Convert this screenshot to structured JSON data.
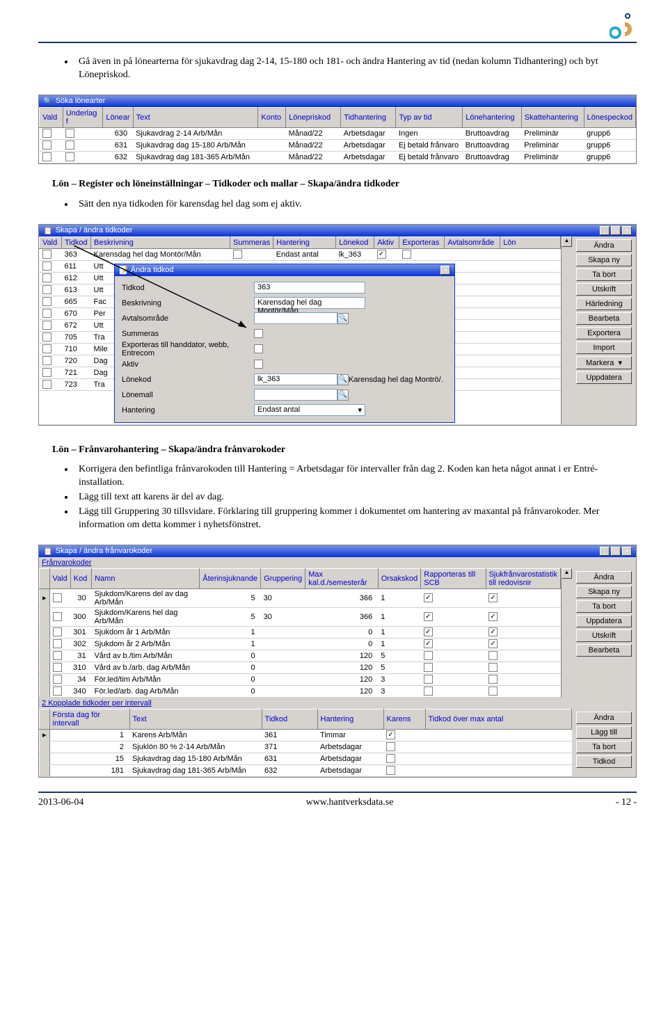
{
  "logo_colors": {
    "top": "#0a3a7a",
    "middle": "#2aa7c7",
    "bottom": "#d7a24a"
  },
  "intro": "Gå även in på lönearterna för sjukavdrag dag 2-14, 15-180 och 181- och ändra Hantering av tid (nedan kolumn Tidhantering) och byt Lönepriskod.",
  "win1": {
    "title": "Söka lönearter",
    "headers": [
      "Vald",
      "Underlag f",
      "Lönear",
      "Text",
      "Konto",
      "Lönepriskod",
      "Tidhantering",
      "Typ av tid",
      "Lönehantering",
      "Skattehantering",
      "Lönespeckod"
    ],
    "rows": [
      {
        "lonear": "630",
        "text": "Sjukavdrag 2-14 Arb/Mån",
        "konto": "",
        "priskod": "Månad/22",
        "tidh": "Arbetsdagar",
        "typ": "Ingen",
        "loneh": "Bruttoavdrag",
        "skatt": "Preliminär",
        "spec": "grupp6"
      },
      {
        "lonear": "631",
        "text": "Sjukavdrag dag 15-180 Arb/Mån",
        "konto": "",
        "priskod": "Månad/22",
        "tidh": "Arbetsdagar",
        "typ": "Ej betald frånvaro",
        "loneh": "Bruttoavdrag",
        "skatt": "Preliminär",
        "spec": "grupp6"
      },
      {
        "lonear": "632",
        "text": "Sjukavdrag dag 181-365 Arb/Mån",
        "konto": "",
        "priskod": "Månad/22",
        "tidh": "Arbetsdagar",
        "typ": "Ej betald frånvaro",
        "loneh": "Bruttoavdrag",
        "skatt": "Preliminär",
        "spec": "grupp6"
      }
    ]
  },
  "heading2": "Lön – Register och löneinställningar – Tidkoder och mallar – Skapa/ändra tidkoder",
  "bullet2": "Sätt den nya tidkoden för karensdag hel dag som ej aktiv.",
  "win2": {
    "title": "Skapa / ändra tidkoder",
    "headers": [
      "Vald",
      "Tidkod",
      "Beskrivning",
      "Summeras",
      "Hantering",
      "Lönekod",
      "Aktiv",
      "Exporteras",
      "Avtalsområde",
      "Lön"
    ],
    "buttons": [
      "Ändra",
      "Skapa ny",
      "Ta bort",
      "Utskrift",
      "Härledning",
      "Bearbeta",
      "Exportera",
      "Import",
      "Markera",
      "Uppdatera"
    ],
    "rows": [
      {
        "tidkod": "363",
        "beskr": "Karensdag hel dag Montör/Mån",
        "sum": false,
        "hant": "Endast antal",
        "lone": "lk_363",
        "aktiv": true,
        "exp": false
      },
      {
        "tidkod": "611",
        "beskr": "Utt"
      },
      {
        "tidkod": "612",
        "beskr": "Utt"
      },
      {
        "tidkod": "613",
        "beskr": "Utt"
      },
      {
        "tidkod": "665",
        "beskr": "Fac"
      },
      {
        "tidkod": "670",
        "beskr": "Per"
      },
      {
        "tidkod": "672",
        "beskr": "Utt"
      },
      {
        "tidkod": "705",
        "beskr": "Tra"
      },
      {
        "tidkod": "710",
        "beskr": "Mile"
      },
      {
        "tidkod": "720",
        "beskr": "Dag"
      },
      {
        "tidkod": "721",
        "beskr": "Dag"
      },
      {
        "tidkod": "723",
        "beskr": "Tra"
      }
    ],
    "dialog": {
      "title": "Ändra tidkod",
      "fields": [
        {
          "label": "Tidkod",
          "value": "363",
          "type": "text"
        },
        {
          "label": "Beskrivning",
          "value": "Karensdag hel dag Montör/Mån",
          "type": "text"
        },
        {
          "label": "Avtalsområde",
          "value": "",
          "type": "textsearch"
        },
        {
          "label": "Summeras",
          "value": false,
          "type": "check"
        },
        {
          "label": "Exporteras till handdator, webb, Entrecom",
          "value": false,
          "type": "check"
        },
        {
          "label": "Aktiv",
          "value": false,
          "type": "check"
        },
        {
          "label": "Lönekod",
          "value": "lk_363",
          "type": "textsearch",
          "suffix": "Karensdag hel dag Montrö/."
        },
        {
          "label": "Lönemall",
          "value": "",
          "type": "textsearch"
        },
        {
          "label": "Hantering",
          "value": "Endast antal",
          "type": "select"
        }
      ]
    }
  },
  "heading3": "Lön – Frånvarohantering – Skapa/ändra frånvarokoder",
  "bullets3": [
    "Korrigera den befintliga frånvarokoden till Hantering = Arbetsdagar för intervaller från dag 2. Koden kan heta något annat i er Entré-installation.",
    "Lägg till text att karens är del av dag.",
    "Lägg till Gruppering 30 tillsvidare. Förklaring till gruppering kommer i dokumentet om hantering av maxantal på frånvarokoder. Mer information om detta kommer i nyhetsfönstret."
  ],
  "win3": {
    "title": "Skapa / ändra frånvarokoder",
    "section1": "Frånvarokoder",
    "headers1": [
      "Vald",
      "Kod",
      "Namn",
      "Återinsjuknande",
      "Gruppering",
      "Max kal.d./semesterår",
      "Orsakskod",
      "Rapporteras till SCB",
      "Sjukfrånvarostatistik till redovisnir"
    ],
    "buttons1": [
      "Ändra",
      "Skapa ny",
      "Ta bort",
      "Uppdatera",
      "Utskrift",
      "Bearbeta"
    ],
    "rows1": [
      {
        "kod": "30",
        "namn": "Sjukdom/Karens del av dag Arb/Mån",
        "ater": "5",
        "grupp": "30",
        "max": "366",
        "ors": "1",
        "scb": true,
        "sjuk": true,
        "sel": true
      },
      {
        "kod": "300",
        "namn": "Sjukdom/Karens hel dag Arb/Mån",
        "ater": "5",
        "grupp": "30",
        "max": "366",
        "ors": "1",
        "scb": true,
        "sjuk": true
      },
      {
        "kod": "301",
        "namn": "Sjukdom år 1 Arb/Mån",
        "ater": "1",
        "grupp": "",
        "max": "0",
        "ors": "1",
        "scb": true,
        "sjuk": true
      },
      {
        "kod": "302",
        "namn": "Sjukdom år 2 Arb/Mån",
        "ater": "1",
        "grupp": "",
        "max": "0",
        "ors": "1",
        "scb": true,
        "sjuk": true
      },
      {
        "kod": "31",
        "namn": "Vård av b./tim Arb/Mån",
        "ater": "0",
        "grupp": "",
        "max": "120",
        "ors": "5",
        "scb": false,
        "sjuk": false
      },
      {
        "kod": "310",
        "namn": "Vård av b./arb. dag Arb/Mån",
        "ater": "0",
        "grupp": "",
        "max": "120",
        "ors": "5",
        "scb": false,
        "sjuk": false
      },
      {
        "kod": "34",
        "namn": "För.led/tim Arb/Mån",
        "ater": "0",
        "grupp": "",
        "max": "120",
        "ors": "3",
        "scb": false,
        "sjuk": false
      },
      {
        "kod": "340",
        "namn": "För.led/arb. dag Arb/Mån",
        "ater": "0",
        "grupp": "",
        "max": "120",
        "ors": "3",
        "scb": false,
        "sjuk": false
      }
    ],
    "section2": "Kopplade tidkoder per intervall",
    "headers2": [
      "Första dag för intervall",
      "Text",
      "Tidkod",
      "Hantering",
      "Karens",
      "Tidkod över max antal"
    ],
    "buttons2": [
      "Ändra",
      "Lägg till",
      "Ta bort",
      "Tidkod"
    ],
    "rows2": [
      {
        "dag": "1",
        "text": "Karens Arb/Mån",
        "tidkod": "361",
        "hant": "Timmar",
        "karens": true,
        "sel": true
      },
      {
        "dag": "2",
        "text": "Sjuklön 80 % 2-14 Arb/Mån",
        "tidkod": "371",
        "hant": "Arbetsdagar",
        "karens": false
      },
      {
        "dag": "15",
        "text": "Sjukavdrag dag 15-180 Arb/Mån",
        "tidkod": "631",
        "hant": "Arbetsdagar",
        "karens": false
      },
      {
        "dag": "181",
        "text": "Sjukavdrag dag 181-365 Arb/Mån",
        "tidkod": "632",
        "hant": "Arbetsdagar",
        "karens": false
      }
    ]
  },
  "footer": {
    "date": "2013-06-04",
    "url": "www.hantverksdata.se",
    "page": "- 12 -"
  }
}
